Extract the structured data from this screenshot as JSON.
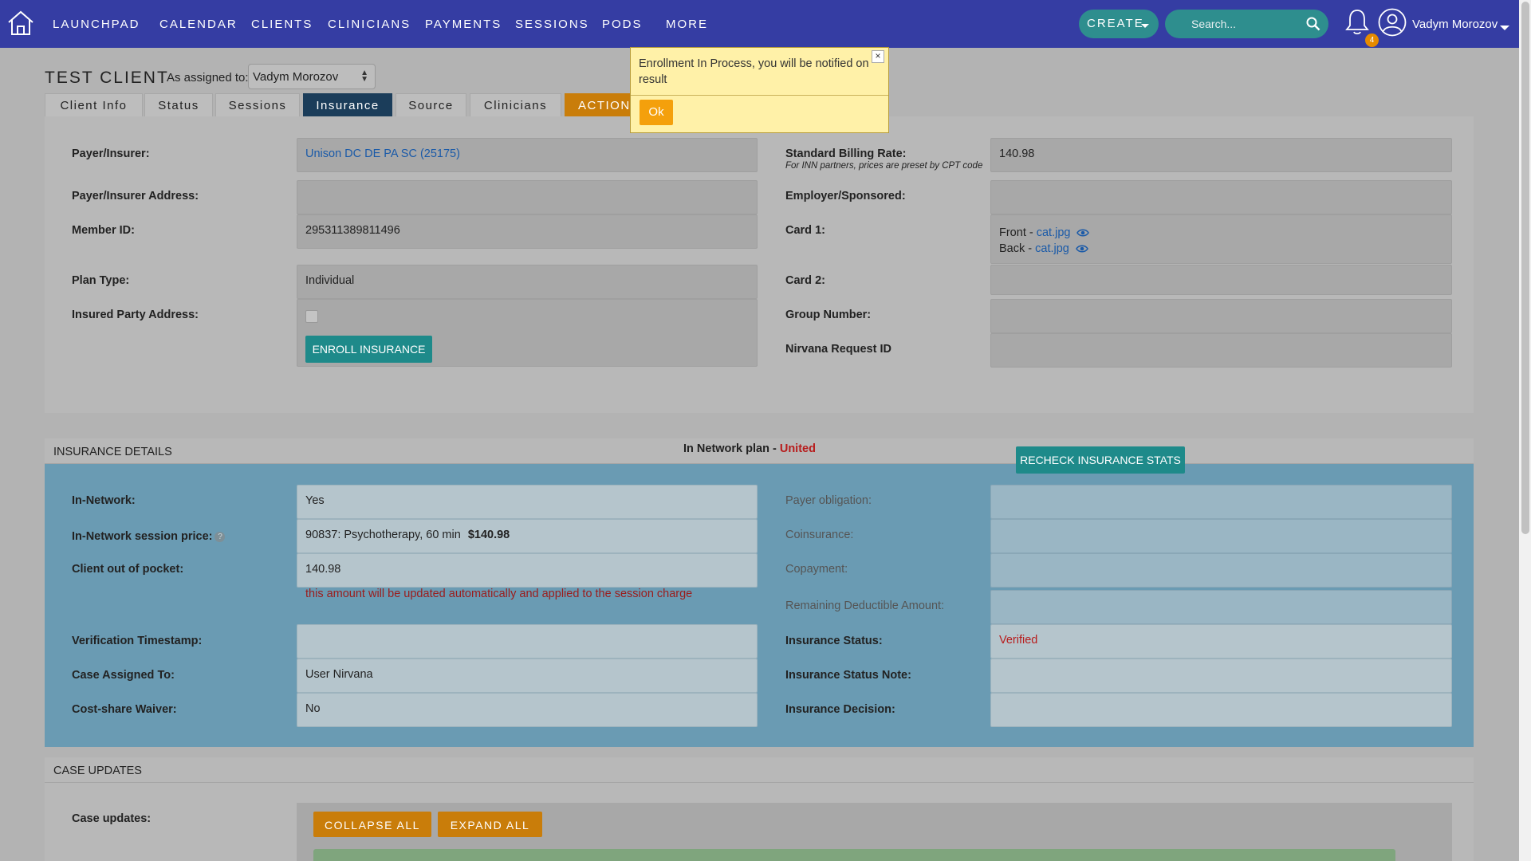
{
  "nav": {
    "items": [
      "LAUNCHPAD",
      "CALENDAR",
      "CLIENTS",
      "CLINICIANS",
      "PAYMENTS",
      "SESSIONS",
      "PODS",
      "MORE"
    ],
    "create_label": "CREATE",
    "search_placeholder": "Search...",
    "notification_count": "4",
    "user_name": "Vadym Morozov"
  },
  "client": {
    "title": "TEST CLIENT",
    "assigned_label": "As assigned to:",
    "assigned_value": "Vadym Morozov"
  },
  "tabs": [
    "Client Info",
    "Status",
    "Sessions",
    "Insurance",
    "Source",
    "Clinicians",
    "ACTIONS"
  ],
  "active_tab": "Insurance",
  "insurance": {
    "payer_label": "Payer/Insurer:",
    "payer_value": "Unison DC DE PA SC (25175)",
    "payer_address_label": "Payer/Insurer Address:",
    "payer_address_value": "",
    "member_id_label": "Member ID:",
    "member_id_value": "295311389811496",
    "plan_type_label": "Plan Type:",
    "plan_type_value": "Individual",
    "insured_address_label": "Insured Party Address:",
    "enroll_button": "ENROLL INSURANCE",
    "billing_rate_label": "Standard Billing Rate:",
    "billing_rate_note": "For INN partners, prices are preset by CPT code",
    "billing_rate_value": "140.98",
    "employer_label": "Employer/Sponsored:",
    "employer_value": "",
    "card1_label": "Card 1:",
    "card1_front_prefix": "Front - ",
    "card1_front_file": "cat.jpg",
    "card1_back_prefix": "Back - ",
    "card1_back_file": "cat.jpg",
    "card2_label": "Card 2:",
    "group_number_label": "Group Number:",
    "nirvana_label": "Nirvana Request ID"
  },
  "details": {
    "section_title": "INSURANCE DETAILS",
    "network_plan_prefix": "In Network plan - ",
    "network_plan_value": "United",
    "recheck_button": "RECHECK INSURANCE STATS",
    "in_network_label": "In-Network:",
    "in_network_value": "Yes",
    "session_price_label": "In-Network session price:",
    "session_price_desc": "90837: Psychotherapy, 60 min",
    "session_price_amount": "$140.98",
    "oop_label": "Client out of pocket:",
    "oop_value": "140.98",
    "oop_hint": "this amount will be updated automatically and applied to the session charge",
    "verification_label": "Verification Timestamp:",
    "verification_value": "",
    "case_assigned_label": "Case Assigned To:",
    "case_assigned_value": "User Nirvana",
    "waiver_label": "Cost-share Waiver:",
    "waiver_value": "No",
    "payer_obligation_label": "Payer obligation:",
    "coinsurance_label": "Coinsurance:",
    "copayment_label": "Copayment:",
    "deductible_label": "Remaining Deductible Amount:",
    "status_label": "Insurance Status:",
    "status_value": "Verified",
    "status_note_label": "Insurance Status Note:",
    "decision_label": "Insurance Decision:"
  },
  "case_updates": {
    "section_title": "CASE UPDATES",
    "label": "Case updates:",
    "collapse_button": "COLLAPSE ALL",
    "expand_button": "EXPAND ALL"
  },
  "modal": {
    "message": "Enrollment In Process, you will be notified on result",
    "close_label": "×",
    "ok_label": "Ok"
  },
  "colors": {
    "nav_bg": "#353da3",
    "teal": "#2e8e8e",
    "orange": "#c97d0a",
    "details_bg": "#6a9bb3",
    "alert_red": "#b71c1c"
  }
}
